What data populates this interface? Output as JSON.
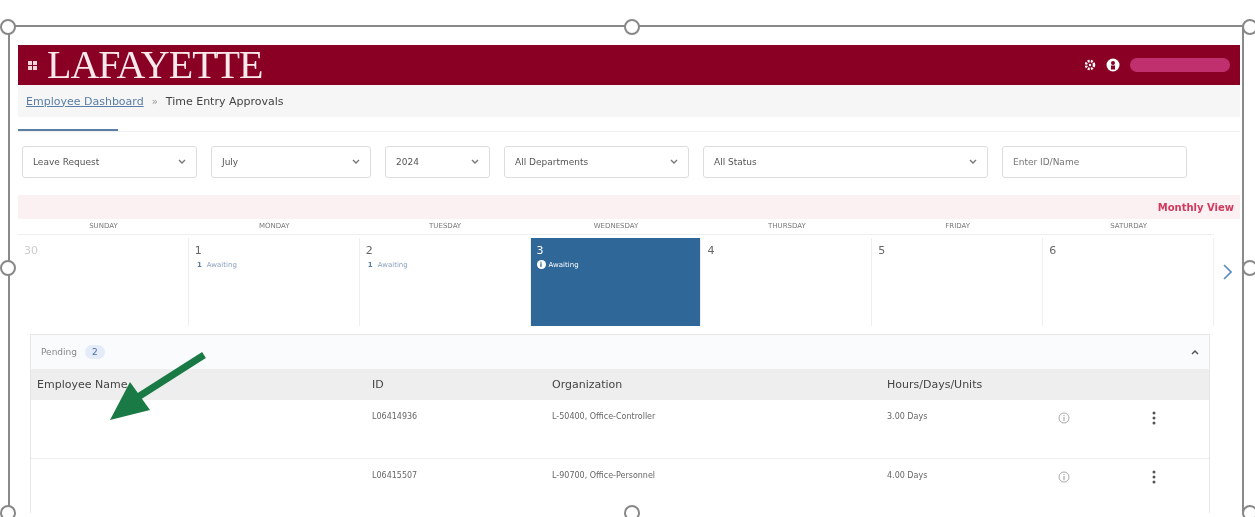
{
  "header": {
    "logo": "LAFAYETTE"
  },
  "breadcrumb": [
    {
      "label": "Employee Dashboard",
      "kind": "link"
    },
    {
      "label": "Time Entry Approvals",
      "kind": "current"
    }
  ],
  "breadcrumb_separator": "»",
  "filters": [
    {
      "kind": "select",
      "value": "Leave Request"
    },
    {
      "kind": "select",
      "value": "July"
    },
    {
      "kind": "select",
      "value": "2024"
    },
    {
      "kind": "select",
      "value": "All Departments"
    },
    {
      "kind": "select",
      "value": "All Status"
    },
    {
      "kind": "input",
      "placeholder": "Enter ID/Name"
    }
  ],
  "view_link": "Monthly View",
  "calendar": {
    "weekdays": [
      "SUNDAY",
      "MONDAY",
      "TUESDAY",
      "WEDNESDAY",
      "THURSDAY",
      "FRIDAY",
      "SATURDAY"
    ],
    "days": [
      {
        "day": "30",
        "muted": true,
        "selected": false
      },
      {
        "day": "1",
        "muted": false,
        "selected": false,
        "count": "1",
        "status": "Awaiting"
      },
      {
        "day": "2",
        "muted": false,
        "selected": false,
        "count": "1",
        "status": "Awaiting"
      },
      {
        "day": "3",
        "muted": false,
        "selected": true,
        "count": "i",
        "status": "Awaiting"
      },
      {
        "day": "4",
        "muted": false,
        "selected": false
      },
      {
        "day": "5",
        "muted": false,
        "selected": false
      },
      {
        "day": "6",
        "muted": false,
        "selected": false
      }
    ]
  },
  "pending": {
    "label": "Pending",
    "count": "2",
    "expanded": true,
    "columns": [
      "Employee Name",
      "ID",
      "Organization",
      "Hours/Days/Units"
    ],
    "rows": [
      {
        "id": "L06414936",
        "organization": "L-50400, Office-Controller",
        "amount": "3.00 Days"
      },
      {
        "id": "L06415507",
        "organization": "L-90700, Office-Personnel",
        "amount": "4.00 Days"
      }
    ]
  }
}
